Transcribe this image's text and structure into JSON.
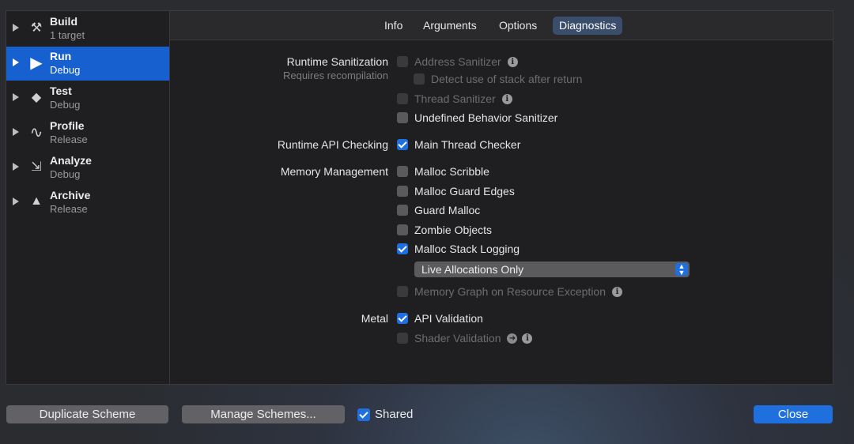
{
  "sidebar": {
    "items": [
      {
        "title": "Build",
        "subtitle": "1 target",
        "icon": "hammer-icon",
        "glyph": "⚒",
        "selected": false
      },
      {
        "title": "Run",
        "subtitle": "Debug",
        "icon": "play-icon",
        "glyph": "▶",
        "selected": true
      },
      {
        "title": "Test",
        "subtitle": "Debug",
        "icon": "test-diamond-icon",
        "glyph": "◆",
        "selected": false
      },
      {
        "title": "Profile",
        "subtitle": "Release",
        "icon": "waveform-icon",
        "glyph": "∿",
        "selected": false
      },
      {
        "title": "Analyze",
        "subtitle": "Debug",
        "icon": "analyze-icon",
        "glyph": "⇲",
        "selected": false
      },
      {
        "title": "Archive",
        "subtitle": "Release",
        "icon": "archive-icon",
        "glyph": "▲",
        "selected": false
      }
    ]
  },
  "tabs": {
    "info": "Info",
    "arguments": "Arguments",
    "options": "Options",
    "diagnostics": "Diagnostics",
    "active": "Diagnostics"
  },
  "sections": {
    "runtime_sanitization": {
      "label": "Runtime Sanitization",
      "sublabel": "Requires recompilation",
      "address_sanitizer": "Address Sanitizer",
      "detect_stack": "Detect use of stack after return",
      "thread_sanitizer": "Thread Sanitizer",
      "ub_sanitizer": "Undefined Behavior Sanitizer"
    },
    "runtime_api": {
      "label": "Runtime API Checking",
      "main_thread_checker": "Main Thread Checker"
    },
    "memory": {
      "label": "Memory Management",
      "malloc_scribble": "Malloc Scribble",
      "malloc_guard_edges": "Malloc Guard Edges",
      "guard_malloc": "Guard Malloc",
      "zombie_objects": "Zombie Objects",
      "malloc_stack_logging": "Malloc Stack Logging",
      "logging_mode": "Live Allocations Only",
      "memory_graph": "Memory Graph on Resource Exception"
    },
    "metal": {
      "label": "Metal",
      "api_validation": "API Validation",
      "shader_validation": "Shader Validation"
    }
  },
  "footer": {
    "duplicate": "Duplicate Scheme",
    "manage": "Manage Schemes...",
    "shared": "Shared",
    "close": "Close"
  },
  "colors": {
    "accent": "#1f6fde",
    "selection": "#1760d0"
  }
}
